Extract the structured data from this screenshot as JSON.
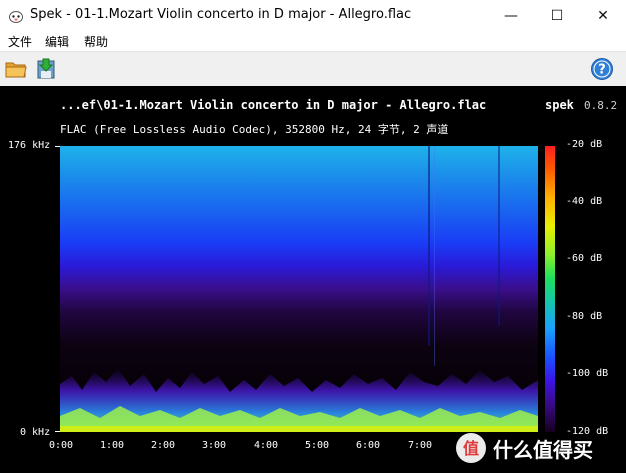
{
  "window": {
    "title": "Spek - 01-1.Mozart Violin concerto in D major - Allegro.flac",
    "minimize_glyph": "—",
    "maximize_glyph": "☐",
    "close_glyph": "✕"
  },
  "menu": {
    "items": [
      "文件",
      "编辑",
      "帮助"
    ]
  },
  "toolbar": {
    "open_icon": "folder-open-icon",
    "save_icon": "save-icon",
    "help_icon": "help-icon"
  },
  "plot": {
    "file_title": "...ef\\01-1.Mozart Violin concerto in D major - Allegro.flac",
    "app_name": "spek",
    "app_version": "0.8.2",
    "file_info": "FLAC (Free Lossless Audio Codec), 352800 Hz, 24 字节, 2 声道",
    "freq_top_label": "176 kHz",
    "freq_bottom_label": "0 kHz",
    "time_labels": [
      "0:00",
      "1:00",
      "2:00",
      "3:00",
      "4:00",
      "5:00",
      "6:00",
      "7:00"
    ],
    "db_labels": [
      "-20 dB",
      "-40 dB",
      "-60 dB",
      "-80 dB",
      "-100 dB",
      "-120 dB"
    ]
  },
  "watermark": {
    "text": "什么值得买"
  }
}
